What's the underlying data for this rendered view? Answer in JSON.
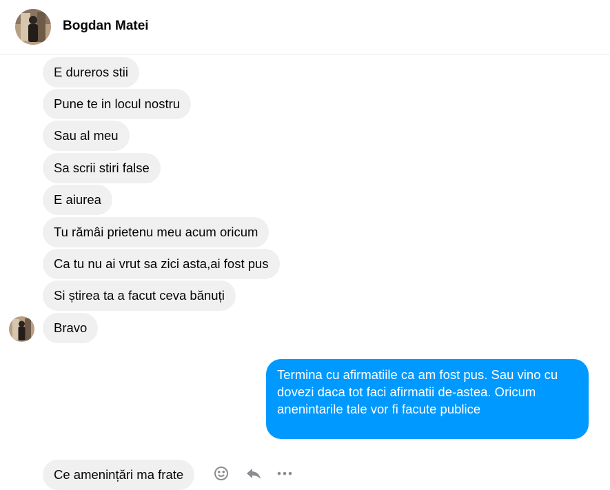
{
  "header": {
    "contact_name": "Bogdan Matei"
  },
  "incoming_messages": [
    "E dureros stii",
    "Pune te in locul nostru",
    "Sau al meu",
    "Sa scrii stiri false",
    "E aiurea",
    "Tu rămâi prietenu meu acum oricum",
    "Ca tu nu ai vrut sa zici asta,ai fost pus",
    "Si știrea ta a facut ceva bănuți",
    "Bravo"
  ],
  "outgoing_message": "Termina cu afirmatiile ca am fost pus. Sau vino cu dovezi daca tot faci afirmatii de-astea.  Oricum anenintarile tale vor fi facute publice",
  "last_incoming": "Ce amenințări ma frate",
  "message_actions": [
    "smile-icon",
    "reply-icon",
    "more-icon"
  ],
  "colors": {
    "outgoing_bubble": "#0099ff",
    "incoming_bubble": "#f0f0f0"
  }
}
